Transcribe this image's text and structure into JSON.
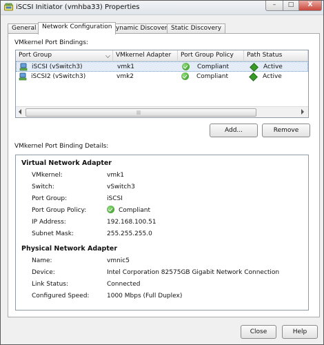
{
  "window": {
    "title": "iSCSI Initiator (vmhba33) Properties",
    "controls": {
      "minimize": "–",
      "maximize": "□",
      "close": "X"
    }
  },
  "tabs": [
    {
      "label": "General",
      "active": false
    },
    {
      "label": "Network Configuration",
      "active": true
    },
    {
      "label": "Dynamic Discovery",
      "active": false
    },
    {
      "label": "Static Discovery",
      "active": false
    }
  ],
  "bindings": {
    "caption": "VMkernel Port Bindings:",
    "columns": [
      "Port Group",
      "VMkernel Adapter",
      "Port Group Policy",
      "Path Status"
    ],
    "rows": [
      {
        "port_group": "iSCSI (vSwitch3)",
        "adapter": "vmk1",
        "policy": "Compliant",
        "status": "Active",
        "selected": true
      },
      {
        "port_group": "iSCSI2 (vSwitch3)",
        "adapter": "vmk2",
        "policy": "Compliant",
        "status": "Active",
        "selected": false
      }
    ],
    "scroll_grip": "|||"
  },
  "actions": {
    "add": "Add...",
    "remove": "Remove"
  },
  "details": {
    "caption": "VMkernel Port Binding Details:",
    "virtual": {
      "title": "Virtual Network Adapter",
      "fields": [
        {
          "label": "VMkernel:",
          "value": "vmk1"
        },
        {
          "label": "Switch:",
          "value": "vSwitch3"
        },
        {
          "label": "Port Group:",
          "value": "iSCSI"
        },
        {
          "label": "Port Group Policy:",
          "value": "Compliant"
        },
        {
          "label": "IP Address:",
          "value": "192.168.100.51"
        },
        {
          "label": "Subnet Mask:",
          "value": "255.255.255.0"
        }
      ]
    },
    "physical": {
      "title": "Physical Network Adapter",
      "fields": [
        {
          "label": "Name:",
          "value": "vmnic5"
        },
        {
          "label": "Device:",
          "value": "Intel Corporation 82575GB Gigabit Network Connection"
        },
        {
          "label": "Link Status:",
          "value": "Connected"
        },
        {
          "label": "Configured Speed:",
          "value": "1000 Mbps (Full Duplex)"
        }
      ]
    }
  },
  "footer": {
    "close": "Close",
    "help": "Help"
  },
  "icons": {
    "app": "iscsi-app-icon",
    "port_group": "network-adapter-icon",
    "compliant": "green-check-icon",
    "active": "green-diamond-icon"
  },
  "colors": {
    "compliant": "#2f8a1e",
    "active": "#3a9a28",
    "selection": "#e4ecf7",
    "close_button": "#c9463b"
  }
}
